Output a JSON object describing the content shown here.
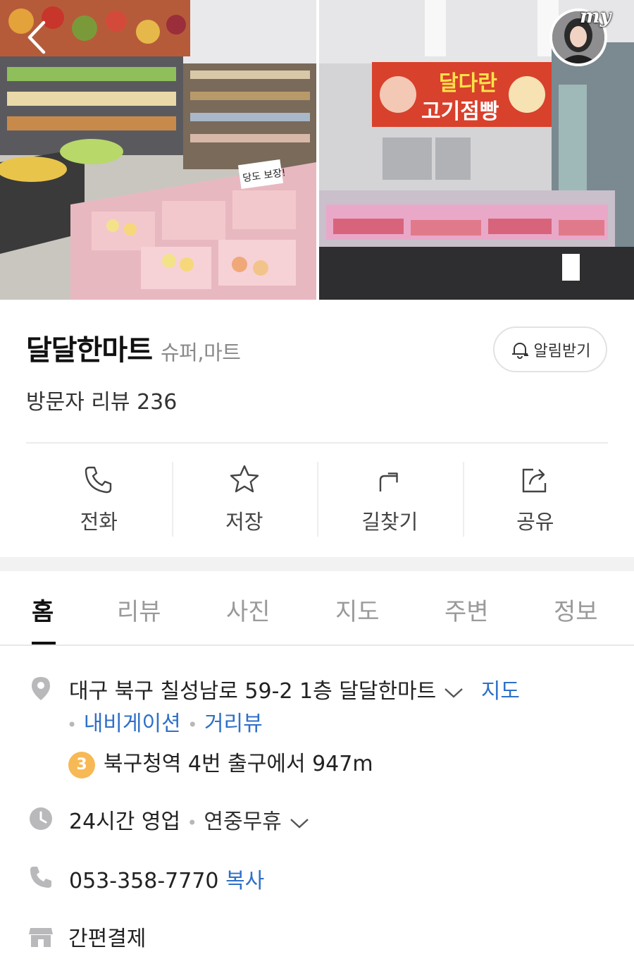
{
  "hero": {
    "left_photo_sign": "당도 보장!",
    "right_photo_banner_line1": "달다란",
    "right_photo_banner_line2": "고기점빵",
    "avatar_badge": "my"
  },
  "place": {
    "name": "달달한마트",
    "category": "슈퍼,마트",
    "review_count_label": "방문자 리뷰 236",
    "alarm_label": "알림받기"
  },
  "actions": [
    {
      "label": "전화",
      "icon": "phone-icon"
    },
    {
      "label": "저장",
      "icon": "star-icon"
    },
    {
      "label": "길찾기",
      "icon": "directions-icon"
    },
    {
      "label": "공유",
      "icon": "share-icon"
    }
  ],
  "tabs": [
    {
      "label": "홈",
      "active": true
    },
    {
      "label": "리뷰",
      "active": false
    },
    {
      "label": "사진",
      "active": false
    },
    {
      "label": "지도",
      "active": false
    },
    {
      "label": "주변",
      "active": false
    },
    {
      "label": "정보",
      "active": false
    }
  ],
  "info": {
    "address": "대구 북구 칠성남로 59-2 1층 달달한마트",
    "map_link": "지도",
    "navigation_link": "내비게이션",
    "street_view_link": "거리뷰",
    "subway_line": "3",
    "subway_text": "북구청역 4번 출구에서 947m",
    "hours": "24시간 영업",
    "holiday": "연중무휴",
    "phone": "053-358-7770",
    "copy_label": "복사",
    "payment": "간편결제"
  },
  "colors": {
    "link": "#2f70c8",
    "subway_line3": "#f7b955",
    "banner_red": "#d8412c"
  }
}
